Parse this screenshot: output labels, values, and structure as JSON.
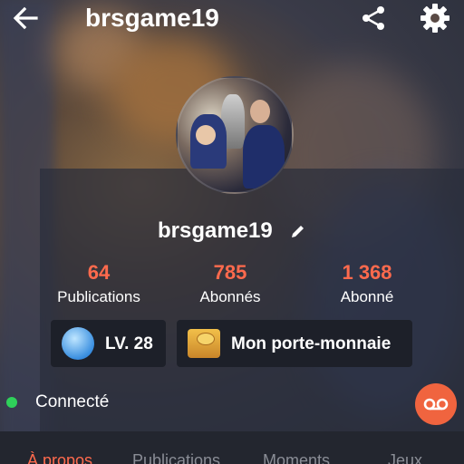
{
  "header": {
    "title": "brsgame19",
    "back_icon": "arrow-left-icon",
    "share_icon": "share-icon",
    "settings_icon": "gear-icon"
  },
  "profile": {
    "username": "brsgame19",
    "edit_icon": "pencil-icon",
    "stats": [
      {
        "value": "64",
        "label": "Publications"
      },
      {
        "value": "785",
        "label": "Abonnés"
      },
      {
        "value": "1 368",
        "label": "Abonné"
      }
    ],
    "level_label": "LV. 28",
    "wallet_label": "Mon porte-monnaie"
  },
  "status": {
    "text": "Connecté",
    "indicator_color": "#2fd15a",
    "voicemail_icon": "voicemail-icon"
  },
  "tabs": [
    {
      "label": "À propos",
      "active": true
    },
    {
      "label": "Publications",
      "active": false
    },
    {
      "label": "Moments",
      "active": false
    },
    {
      "label": "Jeux",
      "active": false
    }
  ],
  "colors": {
    "accent": "#ff6a4d",
    "voicemail_button": "#f0643f"
  }
}
